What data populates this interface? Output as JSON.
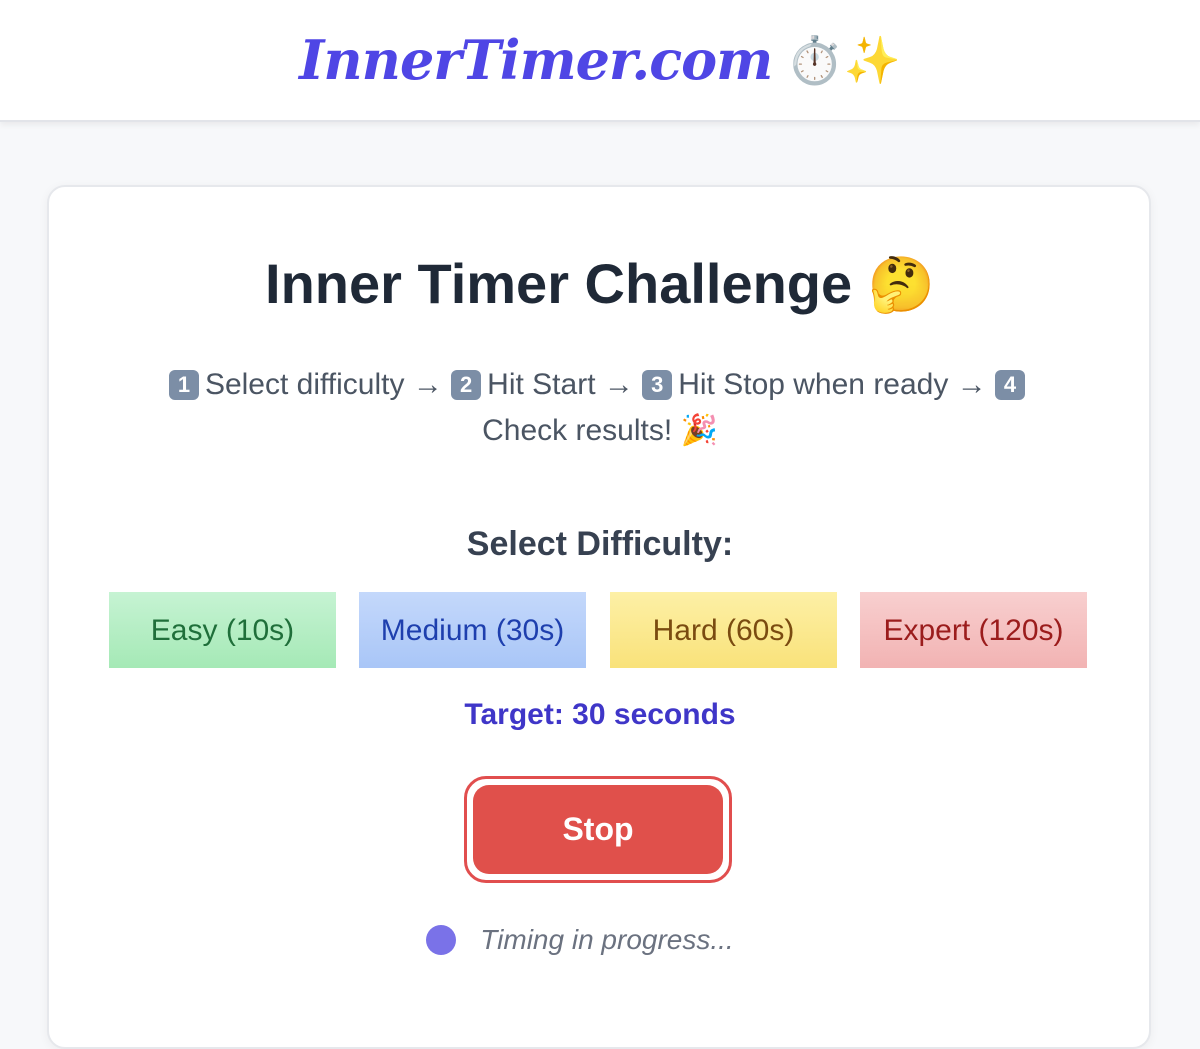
{
  "header": {
    "logo_text": "InnerTimer.com",
    "logo_emojis": "⏱️✨"
  },
  "main": {
    "title": "Inner Timer Challenge",
    "title_emoji": "🤔",
    "instructions": {
      "step1_num": "1",
      "step1_text": "Select difficulty →",
      "step2_num": "2",
      "step2_text": "Hit Start →",
      "step3_num": "3",
      "step3_text": "Hit Stop when ready →",
      "step4_num": "4",
      "step4_text": "Check results! 🎉"
    },
    "difficulty_label": "Select Difficulty:",
    "difficulty_options": [
      {
        "label": "Easy (10s)",
        "color": "#a5e9b6"
      },
      {
        "label": "Medium (30s)",
        "color": "#a9c6f7"
      },
      {
        "label": "Hard (60s)",
        "color": "#f9e27a"
      },
      {
        "label": "Expert (120s)",
        "color": "#f2b3b3"
      }
    ],
    "selected_difficulty": "Medium (30s)",
    "target_text": "Target: 30 seconds",
    "stop_label": "Stop",
    "status_text": "Timing in progress..."
  },
  "colors": {
    "brand": "#4f46e5",
    "stop": "#e0504b",
    "status_dot": "#7a72e8"
  }
}
